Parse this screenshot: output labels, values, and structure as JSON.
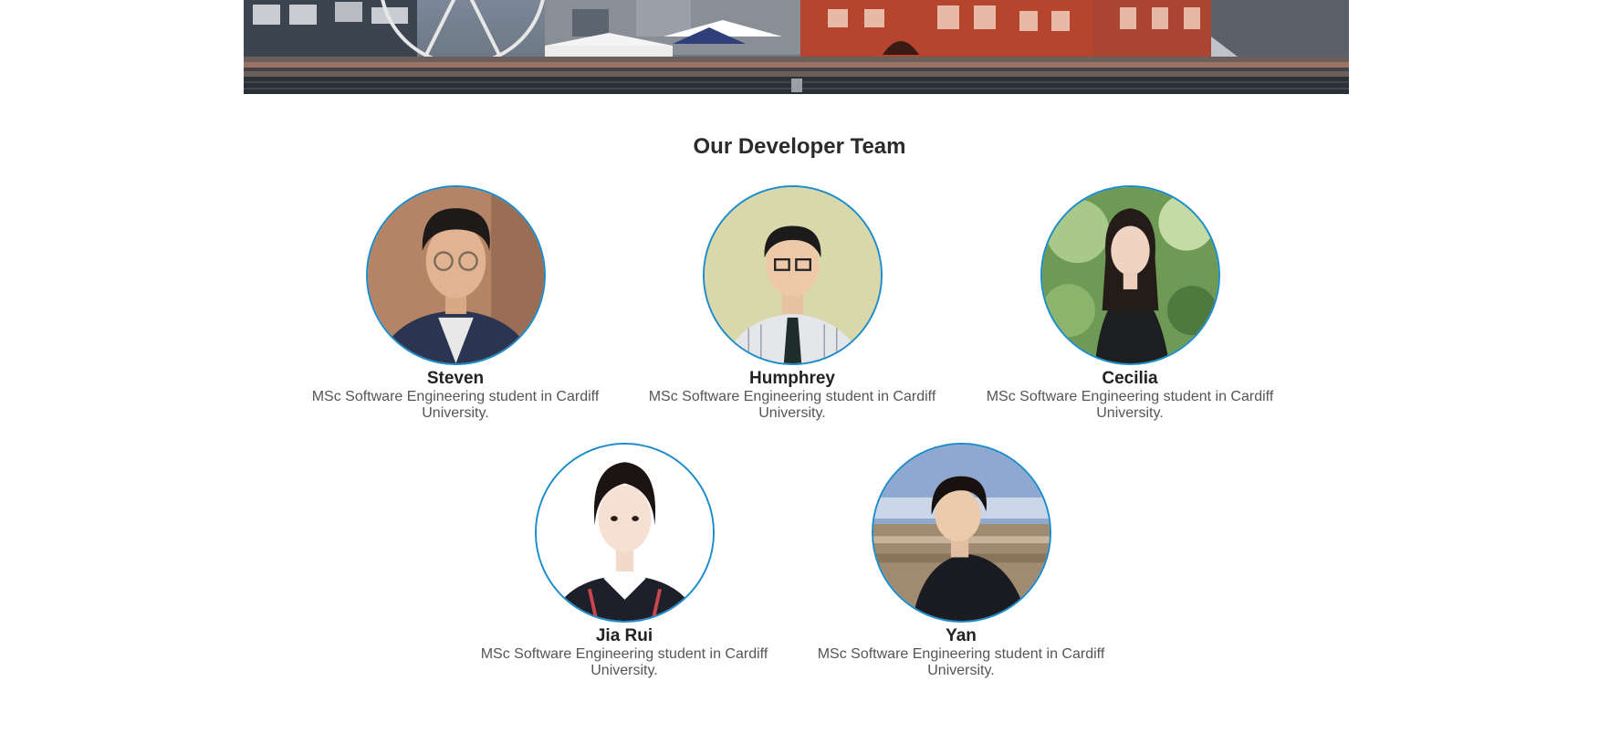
{
  "team": {
    "heading": "Our Developer Team",
    "members": [
      {
        "name": "Steven",
        "role": "MSc Software Engineering student in Cardiff University."
      },
      {
        "name": "Humphrey",
        "role": "MSc Software Engineering student in Cardiff University."
      },
      {
        "name": "Cecilia",
        "role": "MSc Software Engineering student in Cardiff University."
      },
      {
        "name": "Jia Rui",
        "role": "MSc Software Engineering student in Cardiff University."
      },
      {
        "name": "Yan",
        "role": "MSc Software Engineering student in Cardiff University."
      }
    ]
  },
  "theme": {
    "avatar_border": "#1a8ccc",
    "heading_color": "#2b2b2b",
    "text_color": "#555555"
  }
}
